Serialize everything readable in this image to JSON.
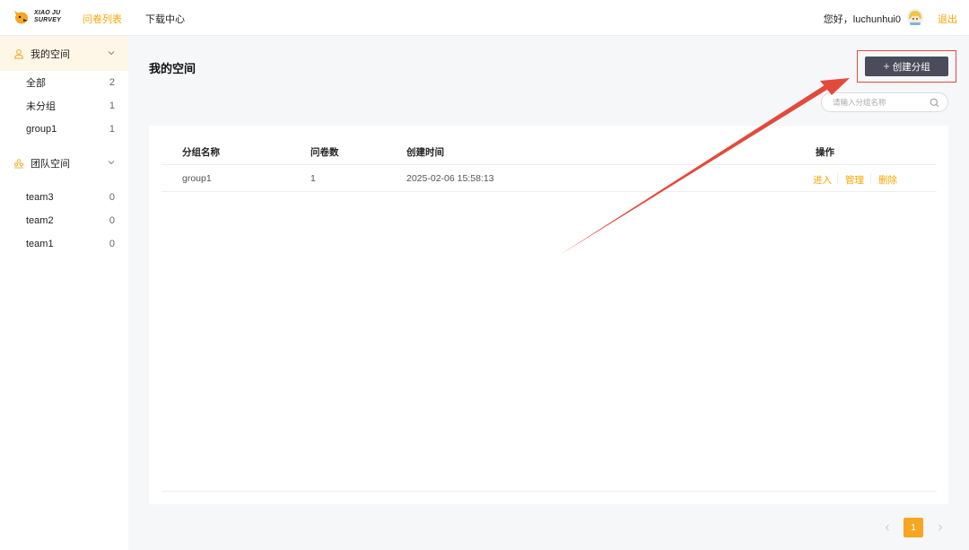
{
  "header": {
    "logo_text_line1": "XIAO JU",
    "logo_text_line2": "SURVEY",
    "nav": [
      {
        "label": "问卷列表",
        "active": true
      },
      {
        "label": "下载中心",
        "active": false
      }
    ],
    "greeting": "您好，luchunhui0",
    "logout_label": "退出"
  },
  "sidebar": {
    "my_space": {
      "label": "我的空间",
      "icon": "user-icon",
      "items": [
        {
          "label": "全部",
          "count": "2"
        },
        {
          "label": "未分组",
          "count": "1"
        },
        {
          "label": "group1",
          "count": "1"
        }
      ]
    },
    "team_space": {
      "label": "团队空间",
      "icon": "team-icon",
      "items": [
        {
          "label": "team3",
          "count": "0"
        },
        {
          "label": "team2",
          "count": "0"
        },
        {
          "label": "team1",
          "count": "0"
        }
      ]
    }
  },
  "main": {
    "title": "我的空间",
    "create_button_label": "创建分组",
    "search_placeholder": "请输入分组名称",
    "table": {
      "columns": [
        "分组名称",
        "问卷数",
        "创建时间",
        "操作"
      ],
      "rows": [
        {
          "name": "group1",
          "count": "1",
          "created": "2025-02-06 15:58:13",
          "actions": [
            "进入",
            "管理",
            "删除"
          ]
        }
      ]
    },
    "pagination": {
      "current": "1",
      "prev_icon": "chevron-left-icon",
      "next_icon": "chevron-right-icon"
    }
  },
  "colors": {
    "accent": "#faa600",
    "button_dark": "#4a4c5b",
    "annotation_red": "#e34a3c",
    "sidebar_active_bg": "#fef6e6"
  }
}
